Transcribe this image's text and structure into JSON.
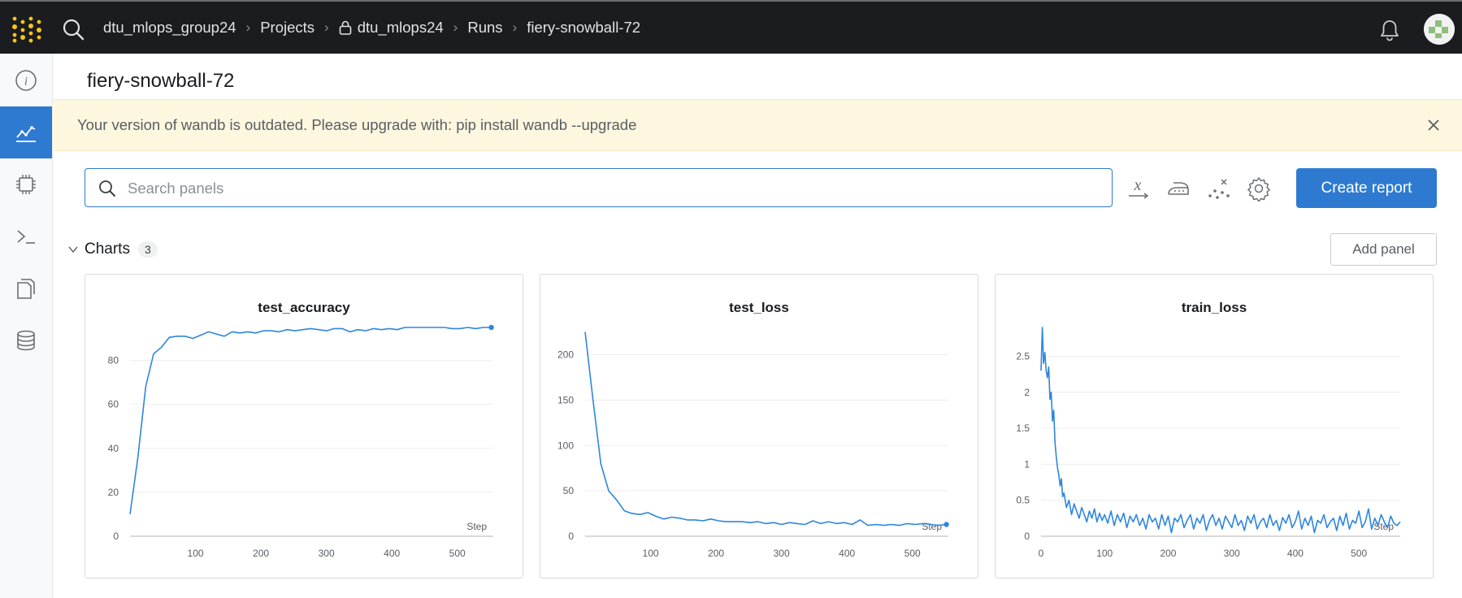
{
  "breadcrumbs": {
    "entity": "dtu_mlops_group24",
    "projects": "Projects",
    "project": "dtu_mlops24",
    "runs": "Runs",
    "run": "fiery-snowball-72"
  },
  "run_title": "fiery-snowball-72",
  "banner": {
    "message": "Your version of wandb is outdated. Please upgrade with: pip install wandb --upgrade"
  },
  "search": {
    "placeholder": "Search panels",
    "value": ""
  },
  "toolbar": {
    "create_report": "Create report"
  },
  "sidebar": {
    "items": [
      "info-icon",
      "charts-icon",
      "system-icon",
      "logs-icon",
      "files-icon",
      "artifacts-icon"
    ],
    "active": "charts-icon"
  },
  "charts_section": {
    "title": "Charts",
    "count": "3",
    "add_panel": "Add panel"
  },
  "colors": {
    "accent": "#2e7ad1",
    "topbar": "#1a1c1f",
    "banner": "#fdf7e0",
    "line": "#2e86de"
  },
  "chart_data": [
    {
      "type": "line",
      "title": "test_accuracy",
      "xlabel": "Step",
      "xlim": [
        0,
        555
      ],
      "ylim": [
        0,
        95
      ],
      "xticks": [
        "100",
        "200",
        "300",
        "400",
        "500"
      ],
      "yticks": [
        "0",
        "20",
        "40",
        "60",
        "80"
      ],
      "grid": true,
      "x": [
        0,
        12,
        24,
        36,
        48,
        60,
        72,
        84,
        96,
        108,
        120,
        132,
        144,
        156,
        168,
        180,
        192,
        204,
        216,
        228,
        240,
        252,
        264,
        276,
        288,
        300,
        312,
        324,
        336,
        348,
        360,
        372,
        384,
        396,
        408,
        420,
        432,
        444,
        456,
        468,
        480,
        492,
        504,
        516,
        528,
        540,
        552
      ],
      "y": [
        10,
        36,
        68,
        83,
        86,
        90.5,
        91,
        91,
        90,
        91.5,
        93,
        92,
        91,
        93,
        92.5,
        93,
        92.5,
        93.5,
        93.5,
        93,
        94,
        93.5,
        94,
        94.5,
        94,
        93.5,
        94.5,
        94.5,
        93,
        94,
        93.5,
        94.5,
        94,
        94.5,
        94,
        95,
        95,
        95,
        95,
        95,
        95,
        94.5,
        94.5,
        95,
        94.5,
        95,
        95
      ]
    },
    {
      "type": "line",
      "title": "test_loss",
      "xlabel": "Step",
      "xlim": [
        0,
        555
      ],
      "ylim": [
        0,
        230
      ],
      "xticks": [
        "100",
        "200",
        "300",
        "400",
        "500"
      ],
      "yticks": [
        "0",
        "50",
        "100",
        "150",
        "200"
      ],
      "grid": true,
      "x": [
        0,
        12,
        24,
        36,
        48,
        60,
        72,
        84,
        96,
        108,
        120,
        132,
        144,
        156,
        168,
        180,
        192,
        204,
        216,
        228,
        240,
        252,
        264,
        276,
        288,
        300,
        312,
        324,
        336,
        348,
        360,
        372,
        384,
        396,
        408,
        420,
        432,
        444,
        456,
        468,
        480,
        492,
        504,
        516,
        528,
        540,
        552
      ],
      "y": [
        225,
        150,
        80,
        50,
        40,
        28,
        25,
        24,
        26,
        22,
        19,
        21,
        20,
        18,
        18,
        17,
        19,
        17,
        16,
        16,
        16,
        15,
        16,
        14,
        15,
        13,
        15,
        14,
        13,
        17,
        14,
        16,
        14,
        15,
        13,
        18,
        12,
        13,
        12,
        13,
        12,
        14,
        13,
        14,
        13,
        12,
        13
      ]
    },
    {
      "type": "line",
      "title": "train_loss",
      "xlabel": "Step",
      "xlim": [
        0,
        565
      ],
      "ylim": [
        0,
        2.9
      ],
      "xticks": [
        "0",
        "100",
        "200",
        "300",
        "400",
        "500"
      ],
      "yticks": [
        "0",
        "0.5",
        "1",
        "1.5",
        "2",
        "2.5"
      ],
      "grid": true,
      "x": [
        0,
        2,
        4,
        6,
        8,
        10,
        12,
        14,
        16,
        18,
        20,
        22,
        24,
        26,
        28,
        30,
        32,
        34,
        36,
        40,
        44,
        48,
        52,
        56,
        60,
        64,
        68,
        72,
        76,
        80,
        84,
        88,
        92,
        96,
        100,
        105,
        110,
        115,
        120,
        125,
        130,
        135,
        140,
        145,
        150,
        155,
        160,
        165,
        170,
        175,
        180,
        185,
        190,
        195,
        200,
        205,
        210,
        215,
        220,
        225,
        230,
        235,
        240,
        245,
        250,
        255,
        260,
        265,
        270,
        275,
        280,
        285,
        290,
        295,
        300,
        305,
        310,
        315,
        320,
        325,
        330,
        335,
        340,
        345,
        350,
        355,
        360,
        365,
        370,
        375,
        380,
        385,
        390,
        395,
        400,
        405,
        410,
        415,
        420,
        425,
        430,
        435,
        440,
        445,
        450,
        455,
        460,
        465,
        470,
        475,
        480,
        485,
        490,
        495,
        500,
        505,
        510,
        515,
        520,
        525,
        530,
        535,
        540,
        545,
        550,
        555,
        560,
        565
      ],
      "y": [
        2.3,
        2.9,
        2.4,
        2.55,
        2.3,
        2.2,
        2.35,
        1.9,
        2.0,
        1.6,
        1.75,
        1.3,
        1.1,
        0.95,
        0.85,
        0.7,
        0.8,
        0.55,
        0.6,
        0.4,
        0.5,
        0.3,
        0.45,
        0.35,
        0.25,
        0.4,
        0.3,
        0.2,
        0.35,
        0.25,
        0.38,
        0.2,
        0.32,
        0.22,
        0.3,
        0.18,
        0.35,
        0.15,
        0.3,
        0.2,
        0.32,
        0.12,
        0.28,
        0.2,
        0.3,
        0.15,
        0.25,
        0.1,
        0.3,
        0.2,
        0.25,
        0.1,
        0.3,
        0.15,
        0.28,
        0.05,
        0.25,
        0.2,
        0.3,
        0.12,
        0.22,
        0.3,
        0.1,
        0.25,
        0.18,
        0.3,
        0.08,
        0.22,
        0.3,
        0.15,
        0.25,
        0.1,
        0.28,
        0.2,
        0.12,
        0.3,
        0.15,
        0.22,
        0.08,
        0.28,
        0.18,
        0.3,
        0.1,
        0.2,
        0.25,
        0.12,
        0.3,
        0.15,
        0.22,
        0.08,
        0.26,
        0.18,
        0.3,
        0.12,
        0.2,
        0.35,
        0.1,
        0.25,
        0.15,
        0.28,
        0.05,
        0.22,
        0.18,
        0.3,
        0.12,
        0.2,
        0.25,
        0.08,
        0.28,
        0.15,
        0.32,
        0.1,
        0.22,
        0.18,
        0.35,
        0.12,
        0.2,
        0.38,
        0.1,
        0.25,
        0.15,
        0.3,
        0.2,
        0.12,
        0.28,
        0.18,
        0.15,
        0.2
      ]
    }
  ]
}
